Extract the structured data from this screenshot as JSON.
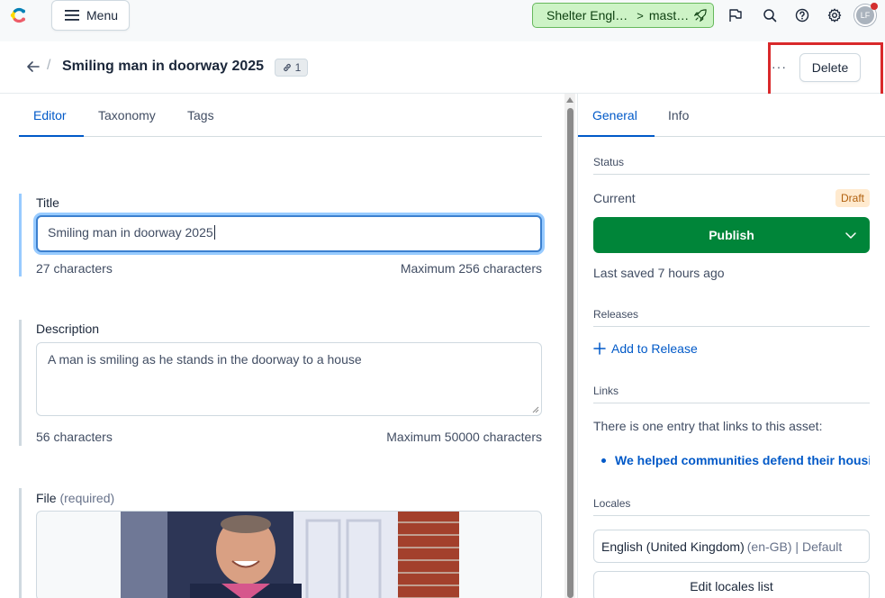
{
  "topbar": {
    "menu_label": "Menu",
    "environment": {
      "space": "Shelter Engl…",
      "separator": ">",
      "branch": "mast…"
    },
    "user_initials": "LF"
  },
  "entity": {
    "title": "Smiling man in doorway 2025",
    "links_count": "1",
    "more_label": "···",
    "delete_label": "Delete"
  },
  "editor": {
    "tabs": [
      {
        "label": "Editor"
      },
      {
        "label": "Taxonomy"
      },
      {
        "label": "Tags"
      }
    ],
    "title_field": {
      "label": "Title",
      "value": "Smiling man in doorway 2025",
      "count": "27 characters",
      "max": "Maximum 256 characters"
    },
    "description_field": {
      "label": "Description",
      "value": "A man is smiling as he stands in the doorway to a house",
      "count": "56 characters",
      "max": "Maximum 50000 characters"
    },
    "file_field": {
      "label": "File",
      "required": "(required)"
    }
  },
  "sidebar": {
    "tabs": [
      {
        "label": "General"
      },
      {
        "label": "Info"
      }
    ],
    "status": {
      "section": "Status",
      "current_label": "Current",
      "badge": "Draft",
      "publish_label": "Publish",
      "last_saved": "Last saved 7 hours ago"
    },
    "releases": {
      "section": "Releases",
      "add_label": "Add to Release"
    },
    "links": {
      "section": "Links",
      "text": "There is one entry that links to this asset:",
      "item": "We helped communities defend their housi"
    },
    "locales": {
      "section": "Locales",
      "locale_name": "English (United Kingdom)",
      "locale_detail": "(en-GB) | Default",
      "edit_label": "Edit locales list"
    }
  },
  "colors": {
    "accent": "#0059c8",
    "publish": "#008539",
    "env_bg": "#cdf3c6",
    "draft_bg": "#ffeacf",
    "highlight": "#d9292b"
  }
}
